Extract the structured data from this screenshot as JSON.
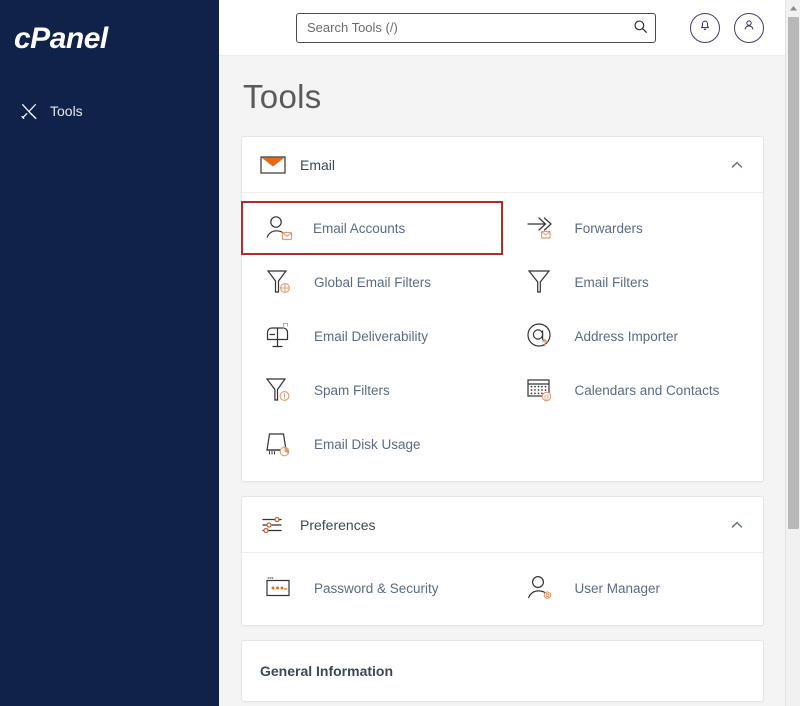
{
  "sidebar": {
    "brand": "cPanel",
    "items": [
      {
        "label": "Tools",
        "icon": "tools-icon"
      }
    ]
  },
  "topbar": {
    "search": {
      "placeholder": "Search Tools (/)",
      "value": "",
      "icon": "search-icon"
    },
    "notifications_icon": "bell-icon",
    "account_icon": "user-icon"
  },
  "main": {
    "page_title": "Tools",
    "sections": [
      {
        "title": "Email",
        "icon": "envelope-icon",
        "expanded": true,
        "collapse_icon": "chevron-up-icon",
        "tiles": [
          {
            "label": "Email Accounts",
            "icon": "user-envelope-icon",
            "highlighted": true
          },
          {
            "label": "Forwarders",
            "icon": "arrow-forward-icon",
            "highlighted": false
          },
          {
            "label": "Global Email Filters",
            "icon": "funnel-globe-icon",
            "highlighted": false
          },
          {
            "label": "Email Filters",
            "icon": "funnel-icon",
            "highlighted": false
          },
          {
            "label": "Email Deliverability",
            "icon": "mailbox-icon",
            "highlighted": false
          },
          {
            "label": "Address Importer",
            "icon": "at-circle-icon",
            "highlighted": false
          },
          {
            "label": "Spam Filters",
            "icon": "funnel-alert-icon",
            "highlighted": false
          },
          {
            "label": "Calendars and Contacts",
            "icon": "calendar-at-icon",
            "highlighted": false
          },
          {
            "label": "Email Disk Usage",
            "icon": "disk-pie-icon",
            "highlighted": false
          }
        ]
      },
      {
        "title": "Preferences",
        "icon": "sliders-icon",
        "expanded": true,
        "collapse_icon": "chevron-up-icon",
        "tiles": [
          {
            "label": "Password & Security",
            "icon": "password-field-icon",
            "highlighted": false
          },
          {
            "label": "User Manager",
            "icon": "user-badge-icon",
            "highlighted": false
          }
        ]
      },
      {
        "title": "General Information",
        "icon": "",
        "expanded": false,
        "collapse_icon": "",
        "tiles": []
      }
    ]
  },
  "colors": {
    "sidebar_bg": "#10214a",
    "accent_orange": "#e8691a",
    "icon_badge": "#e39b74",
    "highlight_red": "#b32b2b",
    "link_text": "#5a6b84"
  },
  "scrollbar": {
    "up_arrow_icon": "caret-up-icon",
    "position_percent": 0
  }
}
